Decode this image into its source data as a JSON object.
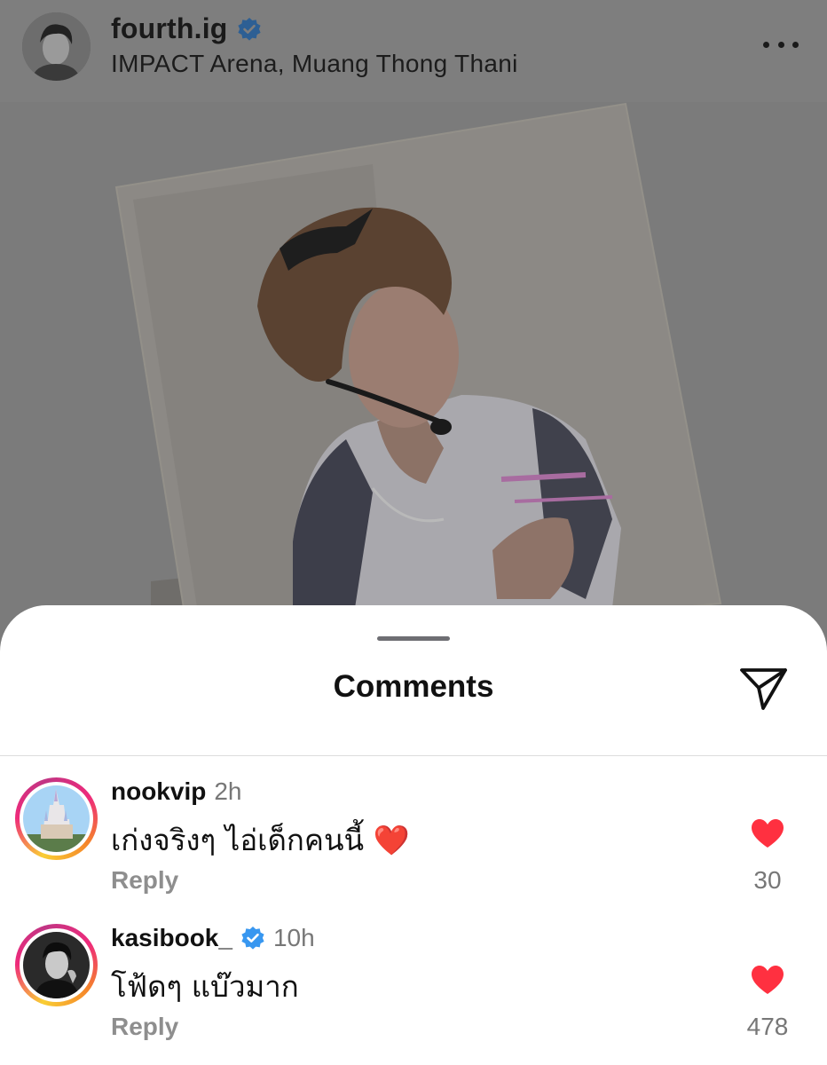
{
  "post": {
    "username": "fourth.ig",
    "location": "IMPACT Arena, Muang Thong Thani"
  },
  "sheet": {
    "title": "Comments"
  },
  "comments": [
    {
      "username": "nookvip",
      "verified": false,
      "time": "2h",
      "text": "เก่งจริงๆ ไอ่เด็กคนนี้ ❤️",
      "reply_label": "Reply",
      "likes": "30"
    },
    {
      "username": "kasibook_",
      "verified": true,
      "time": "10h",
      "text": "โฟ้ดๆ แบ๊วมาก",
      "reply_label": "Reply",
      "likes": "478"
    }
  ],
  "colors": {
    "verified_badge": "#3897f0",
    "heart": "#ff3040",
    "overlay_dim": "#7c7c7c"
  },
  "icons": {
    "more": "more-horizontal-icon",
    "share": "paper-plane-icon",
    "like": "heart-filled-icon",
    "verified": "verified-badge-icon"
  }
}
